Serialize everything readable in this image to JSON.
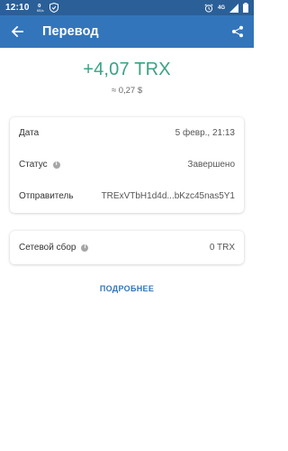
{
  "status_bar": {
    "time": "12:10",
    "network_label": "4G"
  },
  "app_bar": {
    "title": "Перевод"
  },
  "amount": {
    "value": "+4,07 TRX",
    "fiat": "≈ 0,27 $",
    "color": "#3aa284"
  },
  "details": {
    "rows": [
      {
        "label": "Дата",
        "value": "5 февр., 21:13"
      },
      {
        "label": "Статус",
        "value": "Завершено"
      },
      {
        "label": "Отправитель",
        "value": "TRExVTbH1d4d...bKzc45nas5Y1"
      }
    ]
  },
  "fee": {
    "label": "Сетевой сбор",
    "value": "0 TRX"
  },
  "more_button": {
    "label": "ПОДРОБНЕЕ"
  },
  "colors": {
    "status_bar": "#2a5f98",
    "app_bar": "#3375bb",
    "accent": "#3375bb"
  },
  "icons": {
    "back": "arrow-left-icon",
    "share": "share-icon",
    "info": "info-icon"
  }
}
